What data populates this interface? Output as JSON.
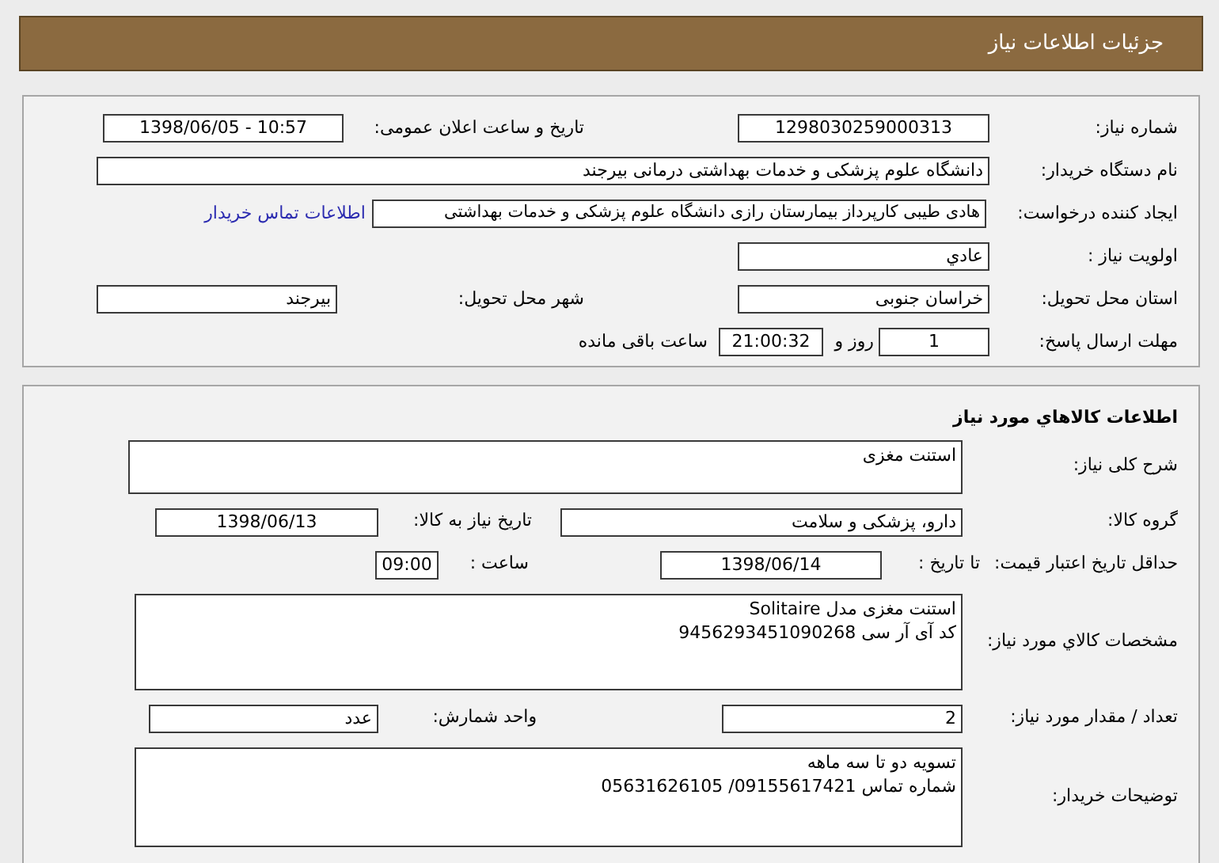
{
  "header": {
    "title": "جزئیات اطلاعات نیاز"
  },
  "need_details": {
    "rows": [
      {
        "cells": [
          {
            "kind": "label",
            "text": "شماره نیاز:"
          },
          {
            "kind": "field",
            "value": "1298030259000313"
          },
          {
            "kind": "label",
            "text": "تاریخ و ساعت اعلان عمومی:"
          },
          {
            "kind": "field",
            "value": "1398/06/05 - 10:57"
          }
        ]
      },
      {
        "cells": [
          {
            "kind": "label",
            "text": "نام دستگاه خریدار:"
          },
          {
            "kind": "field",
            "value": "دانشگاه علوم پزشکی و خدمات بهداشتی درمانی بیرجند"
          }
        ]
      },
      {
        "cells": [
          {
            "kind": "label",
            "text": "ایجاد کننده درخواست:"
          },
          {
            "kind": "field",
            "value": "هادی طیبی کارپرداز بیمارستان رازی دانشگاه علوم پزشکی و خدمات بهداشتی"
          }
        ],
        "contact_link": {
          "text": "اطلاعات تماس خریدار"
        }
      },
      {
        "cells": [
          {
            "kind": "label",
            "text": "اولویت نیاز :"
          },
          {
            "kind": "field",
            "value": "عادي"
          }
        ]
      },
      {
        "cells": [
          {
            "kind": "label",
            "text": "استان محل تحویل:"
          },
          {
            "kind": "field",
            "value": "خراسان جنوبی"
          },
          {
            "kind": "label",
            "text": "شهر محل تحویل:"
          },
          {
            "kind": "field",
            "value": "بیرجند"
          }
        ]
      },
      {
        "cells": [
          {
            "kind": "label",
            "text": "مهلت ارسال پاسخ:"
          },
          {
            "kind": "group",
            "items": [
              {
                "kind": "field",
                "value": "1"
              },
              {
                "kind": "label",
                "text": "روز و"
              },
              {
                "kind": "field",
                "value": "21:00:32"
              },
              {
                "kind": "label",
                "text": "ساعت باقی مانده"
              }
            ]
          }
        ]
      }
    ]
  },
  "goods": {
    "title": "اطلاعات کالاهاي مورد نیاز",
    "rows": [
      {
        "cells": [
          {
            "kind": "label",
            "text": "شرح کلی نیاز:"
          },
          {
            "kind": "field",
            "lines": [
              "استنت مغزی"
            ]
          }
        ]
      },
      {
        "cells": [
          {
            "kind": "label",
            "text": "گروه کالا:"
          },
          {
            "kind": "field",
            "value": "دارو، پزشکی و سلامت"
          },
          {
            "kind": "label",
            "text": "تاریخ نیاز به کالا:"
          },
          {
            "kind": "field",
            "value": "1398/06/13"
          }
        ]
      },
      {
        "cells": [
          {
            "kind": "label",
            "text": "حداقل تاریخ اعتبار قیمت:"
          },
          {
            "kind": "group",
            "items": [
              {
                "kind": "label",
                "text": "تا تاریخ :"
              },
              {
                "kind": "field",
                "value": "1398/06/14"
              },
              {
                "kind": "label",
                "text": "ساعت :"
              },
              {
                "kind": "field",
                "value": "09:00"
              }
            ]
          }
        ]
      },
      {
        "cells": [
          {
            "kind": "label",
            "text": "مشخصات کالاي مورد نیاز:"
          },
          {
            "kind": "field",
            "lines": [
              "استنت مغزی مدل Solitaire",
              "کد آی آر سی 9456293451090268"
            ]
          }
        ]
      },
      {
        "cells": [
          {
            "kind": "label",
            "text": "تعداد / مقدار مورد نیاز:"
          },
          {
            "kind": "field",
            "value": "2"
          },
          {
            "kind": "label",
            "text": "واحد شمارش:"
          },
          {
            "kind": "field",
            "value": "عدد"
          }
        ]
      },
      {
        "cells": [
          {
            "kind": "label",
            "text": "توضیحات خریدار:"
          },
          {
            "kind": "field",
            "lines": [
              "تسویه دو تا سه ماهه",
              "شماره تماس 09155617421/ 05631626105"
            ]
          }
        ]
      }
    ]
  }
}
